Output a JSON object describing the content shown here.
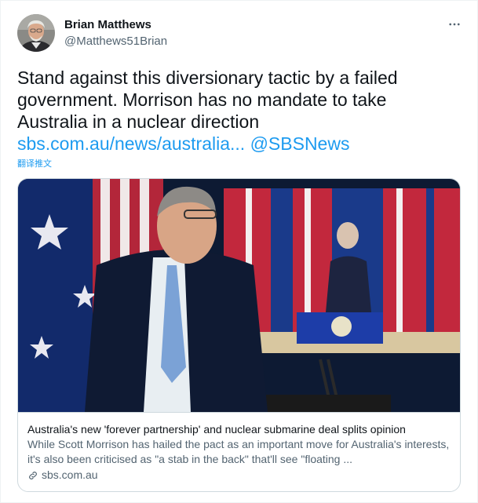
{
  "author": {
    "name": "Brian Matthews",
    "handle": "@Matthews51Brian"
  },
  "tweet": {
    "lines": [
      "Stand against this diversionary tactic by a failed",
      "government. Morrison has no mandate to take",
      "Australia in a nuclear direction"
    ],
    "link_text": "sbs.com.au/news/australia...",
    "mention": "@SBSNews",
    "translate_label": "翻译推文"
  },
  "card": {
    "title": "Australia's new 'forever partnership' and nuclear submarine deal splits opinion",
    "description": "While Scott Morrison has hailed the pact as an important move for Australia's interests, it's also been criticised as \"a stab in the back\" that'll see \"floating ...",
    "domain": "sbs.com.au"
  },
  "icons": {
    "more": "more-dots-icon",
    "link": "link-icon"
  },
  "colors": {
    "link": "#1d9bf0",
    "secondary_text": "#536471",
    "border": "#cfd9de"
  }
}
